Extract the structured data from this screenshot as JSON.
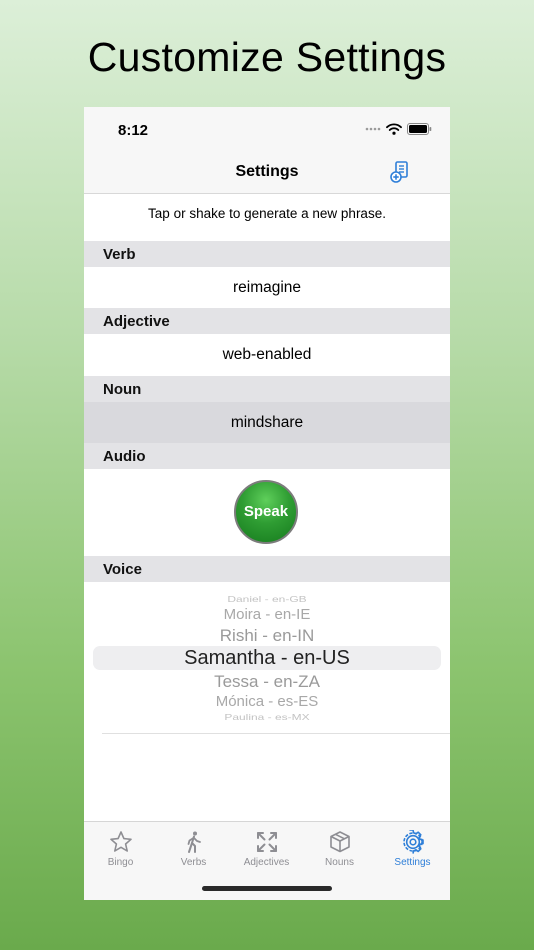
{
  "headline": "Customize Settings",
  "status_bar": {
    "time": "8:12"
  },
  "nav": {
    "title": "Settings"
  },
  "instruction": "Tap or shake to generate a new phrase.",
  "sections": {
    "verb": {
      "header": "Verb",
      "value": "reimagine"
    },
    "adjective": {
      "header": "Adjective",
      "value": "web-enabled"
    },
    "noun": {
      "header": "Noun",
      "value": "mindshare"
    },
    "audio": {
      "header": "Audio",
      "button_label": "Speak"
    },
    "voice": {
      "header": "Voice",
      "options": [
        "Daniel - en-GB",
        "Moira - en-IE",
        "Rishi - en-IN",
        "Samantha - en-US",
        "Tessa - en-ZA",
        "Mónica - es-ES",
        "Paulina - es-MX"
      ],
      "selected": "Samantha - en-US"
    }
  },
  "tabs": [
    {
      "label": "Bingo",
      "icon": "star-icon"
    },
    {
      "label": "Verbs",
      "icon": "walking-figure-icon"
    },
    {
      "label": "Adjectives",
      "icon": "arrows-expand-icon"
    },
    {
      "label": "Nouns",
      "icon": "box-icon"
    },
    {
      "label": "Settings",
      "icon": "gear-icon",
      "active": true
    }
  ],
  "colors": {
    "accent": "#2f7fd8",
    "speak_green": "#2f9d33",
    "section_header_bg": "#e3e3e6",
    "background_gradient_top": "#dcefd8",
    "background_gradient_bottom": "#6aaa4c"
  }
}
